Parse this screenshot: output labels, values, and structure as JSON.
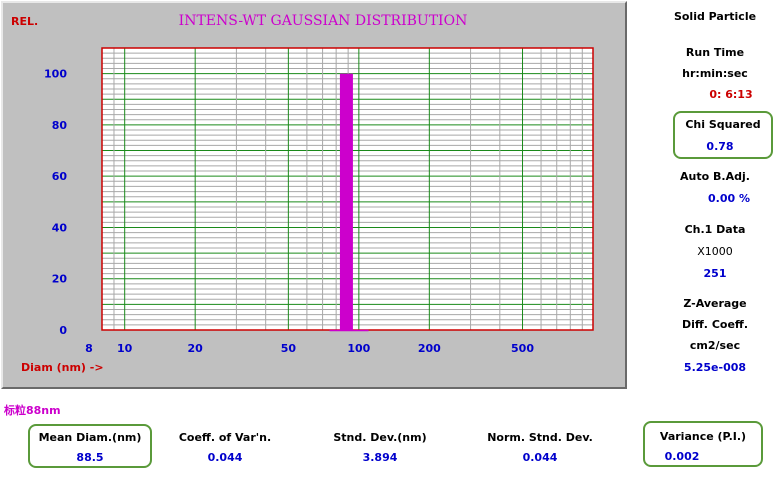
{
  "rel_label": "REL.",
  "chart_title": "INTENS-WT GAUSSIAN DISTRIBUTION",
  "x_axis_label": "Diam (nm) ->",
  "sample_label": "标粒88nm",
  "chart_data": {
    "type": "bar",
    "title": "INTENS-WT GAUSSIAN DISTRIBUTION",
    "xlabel": "Diam (nm) ->",
    "ylabel": "REL.",
    "x_scale": "log",
    "xlim": [
      8,
      1000
    ],
    "ylim": [
      0,
      110
    ],
    "x_tick_labels": [
      "8",
      "10",
      "20",
      "50",
      "100",
      "200",
      "500"
    ],
    "x_ticks": [
      8,
      10,
      20,
      50,
      100,
      200,
      500
    ],
    "y_ticks": [
      0,
      20,
      40,
      60,
      80,
      100
    ],
    "grid": true,
    "bars": [
      {
        "x": 88.5,
        "value": 100
      }
    ],
    "colors": {
      "bar": "#cc00cc",
      "grid_major": "#1a8a1a",
      "grid_minor": "#a8a8a8",
      "axis_text": "#0000cc",
      "title": "#cc00cc",
      "frame": "#cc0000"
    }
  },
  "right_panel": {
    "particle_type": "Solid Particle",
    "run_time_label": "Run Time",
    "run_time_format": "hr:min:sec",
    "run_time_value": "0: 6:13",
    "chi_squared_label": "Chi Squared",
    "chi_squared_value": "0.78",
    "auto_badj_label": "Auto B.Adj.",
    "auto_badj_value": "0.00 %",
    "ch1_label": "Ch.1 Data",
    "ch1_multiplier": "X1000",
    "ch1_value": "251",
    "zavg_label": "Z-Average",
    "diff_coeff_label": "Diff. Coeff.",
    "diff_units": "cm2/sec",
    "diff_value": "5.25e-008"
  },
  "stats": {
    "mean_diam_label": "Mean Diam.(nm)",
    "mean_diam_value": "88.5",
    "coeff_var_label": "Coeff. of Var'n.",
    "coeff_var_value": "0.044",
    "std_dev_label": "Stnd. Dev.(nm)",
    "std_dev_value": "3.894",
    "norm_std_label": "Norm. Stnd. Dev.",
    "norm_std_value": "0.044",
    "variance_label": "Variance (P.I.)",
    "variance_value": "0.002"
  }
}
